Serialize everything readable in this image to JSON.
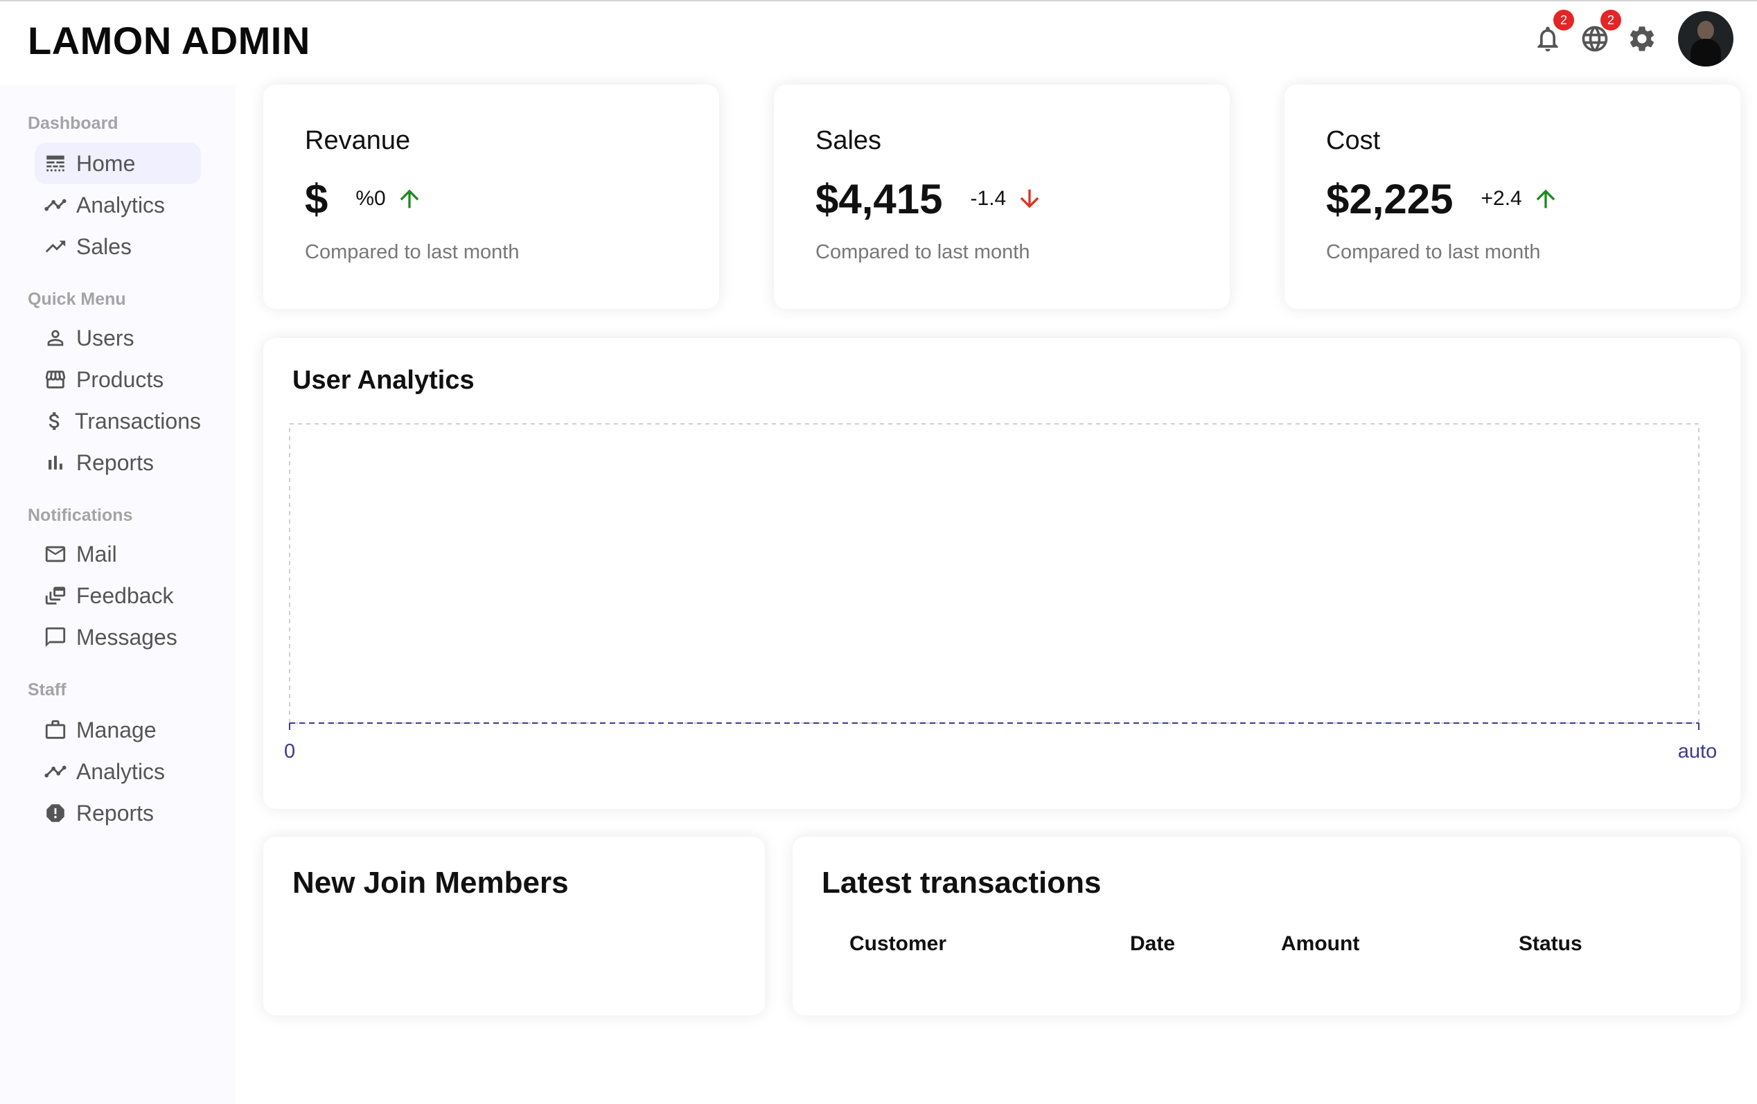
{
  "app": {
    "title": "LAMON ADMIN"
  },
  "topbar": {
    "notifications": {
      "icon": "bell-icon",
      "badge": "2"
    },
    "language": {
      "icon": "globe-icon",
      "badge": "2"
    },
    "settings": {
      "icon": "gear-icon"
    },
    "avatar": {
      "icon": "user-avatar"
    }
  },
  "sidebar": {
    "sections": [
      {
        "title": "Dashboard",
        "items": [
          {
            "label": "Home",
            "icon": "line-style-icon",
            "active": true
          },
          {
            "label": "Analytics",
            "icon": "timeline-icon"
          },
          {
            "label": "Sales",
            "icon": "trending-up-icon"
          }
        ]
      },
      {
        "title": "Quick Menu",
        "items": [
          {
            "label": "Users",
            "icon": "person-icon"
          },
          {
            "label": "Products",
            "icon": "storefront-icon"
          },
          {
            "label": "Transactions",
            "icon": "dollar-icon"
          },
          {
            "label": "Reports",
            "icon": "bar-chart-icon"
          }
        ]
      },
      {
        "title": "Notifications",
        "items": [
          {
            "label": "Mail",
            "icon": "mail-icon"
          },
          {
            "label": "Feedback",
            "icon": "dynamic-feed-icon"
          },
          {
            "label": "Messages",
            "icon": "chat-bubble-icon"
          }
        ]
      },
      {
        "title": "Staff",
        "items": [
          {
            "label": "Manage",
            "icon": "work-icon"
          },
          {
            "label": "Analytics",
            "icon": "timeline-icon"
          },
          {
            "label": "Reports",
            "icon": "report-icon"
          }
        ]
      }
    ]
  },
  "featured": [
    {
      "title": "Revanue",
      "money": "$",
      "rate": "%0",
      "trend": "up",
      "subtitle": "Compared to last month"
    },
    {
      "title": "Sales",
      "money": "$4,415",
      "rate": "-1.4",
      "trend": "down",
      "subtitle": "Compared to last month"
    },
    {
      "title": "Cost",
      "money": "$2,225",
      "rate": "+2.4",
      "trend": "up",
      "subtitle": "Compared to last month"
    }
  ],
  "colors": {
    "up": "#1e8a1e",
    "down": "#e0321f",
    "axis": "#3b3b8f",
    "badge": "#e32525"
  },
  "chart": {
    "title": "User Analytics",
    "chart_data": {
      "type": "line",
      "title": "User Analytics",
      "x_tick_labels": [
        "0",
        "auto"
      ],
      "series": [],
      "grid": true
    }
  },
  "widget_small": {
    "title": "New Join Members"
  },
  "widget_large": {
    "title": "Latest transactions",
    "headers": [
      "Customer",
      "Date",
      "Amount",
      "Status"
    ]
  }
}
